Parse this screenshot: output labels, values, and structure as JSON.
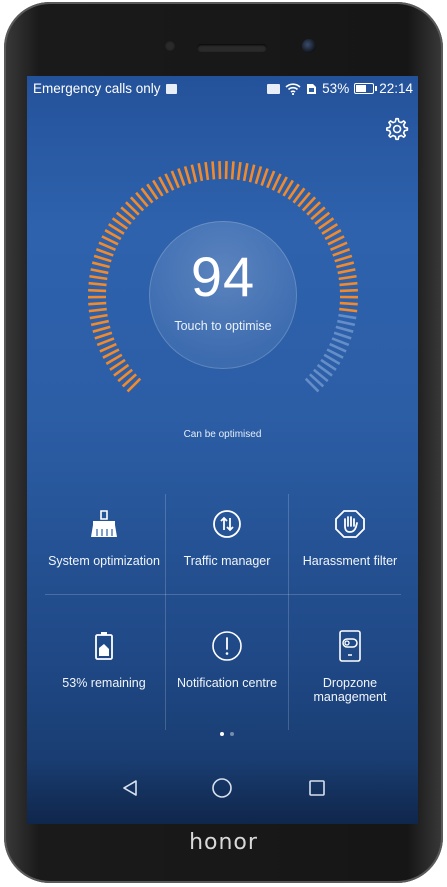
{
  "status_bar": {
    "left_text": "Emergency calls only",
    "battery_percent": "53%",
    "battery_level": 0.53,
    "time": "22:14",
    "icons": [
      "image-notification-icon",
      "nfc-icon",
      "wifi-icon",
      "sim-icon",
      "battery-icon"
    ]
  },
  "gauge": {
    "score": "94",
    "action_label": "Touch to optimise",
    "status_text": "Can be optimised",
    "fill_fraction": 0.86,
    "accent_color": "#f08a2c"
  },
  "tiles": [
    {
      "label": "System optimization",
      "icon": "broom-icon"
    },
    {
      "label": "Traffic manager",
      "icon": "traffic-icon"
    },
    {
      "label": "Harassment filter",
      "icon": "hand-stop-icon"
    },
    {
      "label": "53% remaining",
      "icon": "battery-tile-icon"
    },
    {
      "label": "Notification centre",
      "icon": "exclamation-icon"
    },
    {
      "label": "Dropzone management",
      "icon": "dropzone-icon"
    }
  ],
  "pagination": {
    "current": 1,
    "total": 2
  },
  "navigation": {
    "buttons": [
      "back-button",
      "home-button",
      "recents-button"
    ]
  },
  "device": {
    "brand": "honor"
  }
}
